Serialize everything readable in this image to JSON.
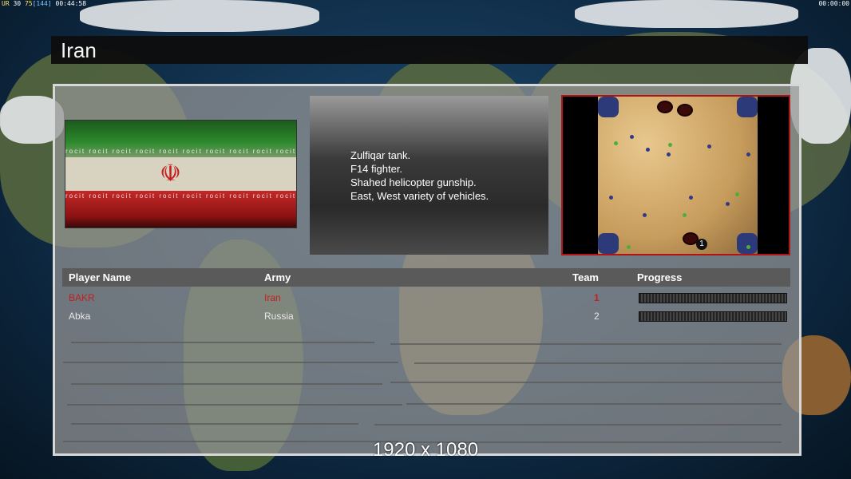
{
  "hud": {
    "left_a": "UR",
    "left_b": "30",
    "left_c": "75",
    "left_d": "[144]",
    "left_time": "00:44:58",
    "right_time": "00:00:00"
  },
  "title": "Iran",
  "description": [
    "Zulfiqar tank.",
    "F14 fighter.",
    "Shahed helicopter gunship.",
    "East, West variety of vehicles."
  ],
  "map": {
    "start_label": "1"
  },
  "table": {
    "headers": {
      "player": "Player Name",
      "army": "Army",
      "team": "Team",
      "progress": "Progress"
    },
    "rows": [
      {
        "player": "BAKR",
        "army": "Iran",
        "team": "1",
        "progress": 0.0,
        "color": "#c41e1e"
      },
      {
        "player": "Abka",
        "army": "Russia",
        "team": "2",
        "progress": 0.0,
        "color": "#e8e8e8"
      }
    ]
  },
  "resolution": "1920 x 1080",
  "colors": {
    "accent_red": "#b01414",
    "panel_border": "#d7d7d7"
  }
}
